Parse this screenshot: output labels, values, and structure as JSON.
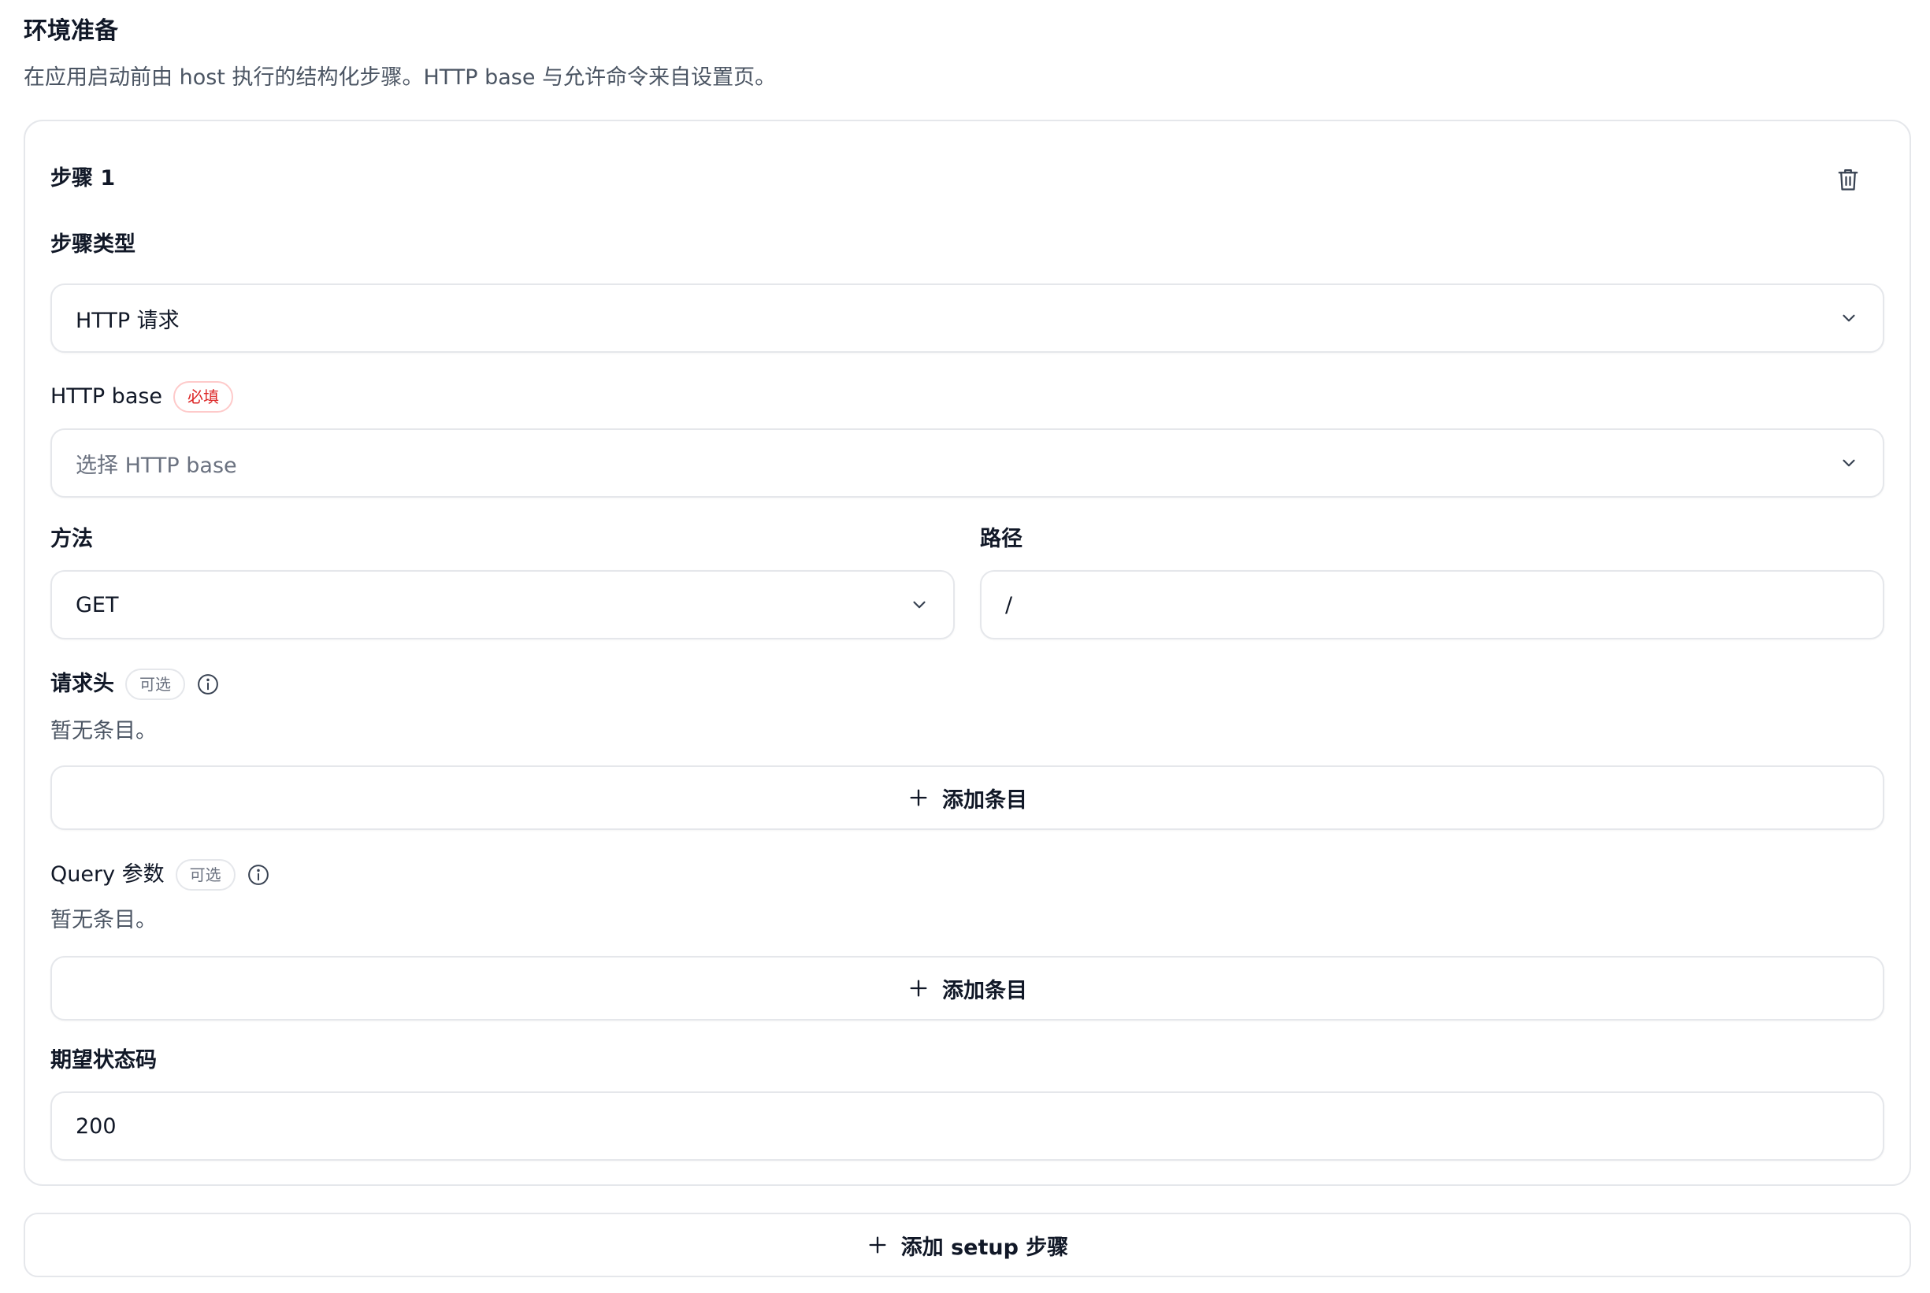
{
  "section": {
    "title": "环境准备",
    "description": "在应用启动前由 host 执行的结构化步骤。HTTP base 与允许命令来自设置页。"
  },
  "step": {
    "title": "步骤 1",
    "delete_icon": "trash-icon",
    "type": {
      "label": "步骤类型",
      "value": "HTTP 请求"
    },
    "http_base": {
      "label": "HTTP base",
      "badge": "必填",
      "placeholder": "选择 HTTP base"
    },
    "method": {
      "label": "方法",
      "value": "GET"
    },
    "path": {
      "label": "路径",
      "value": "/"
    },
    "headers": {
      "label": "请求头",
      "badge": "可选",
      "empty": "暂无条目。",
      "add_label": "添加条目"
    },
    "query": {
      "label": "Query 参数",
      "badge": "可选",
      "empty": "暂无条目。",
      "add_label": "添加条目"
    },
    "expected_status": {
      "label": "期望状态码",
      "value": "200"
    }
  },
  "add_setup": {
    "label": "添加 setup 步骤"
  },
  "colors": {
    "border": "#e5e7eb",
    "required": "#dc2626",
    "muted": "#6b7280",
    "text": "#111827"
  }
}
